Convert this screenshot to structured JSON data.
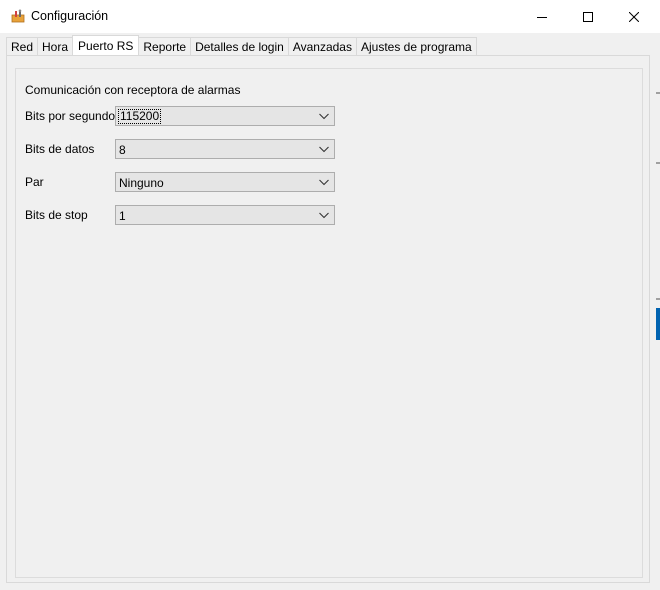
{
  "window": {
    "title": "Configuración",
    "icon": "settings-tools-icon",
    "controls": {
      "minimize_icon": "minimize-icon",
      "maximize_icon": "maximize-icon",
      "close_icon": "close-icon"
    }
  },
  "tabs": [
    {
      "label": "Red",
      "active": false
    },
    {
      "label": "Hora",
      "active": false
    },
    {
      "label": "Puerto RS",
      "active": true
    },
    {
      "label": "Reporte",
      "active": false
    },
    {
      "label": "Detalles de login",
      "active": false
    },
    {
      "label": "Avanzadas",
      "active": false
    },
    {
      "label": "Ajustes de programa",
      "active": false
    }
  ],
  "panel": {
    "section_title": "Comunicación con receptora de alarmas",
    "fields": [
      {
        "label": "Bits por segundos",
        "value": "115200"
      },
      {
        "label": "Bits de datos",
        "value": "8"
      },
      {
        "label": "Par",
        "value": "Ninguno"
      },
      {
        "label": "Bits de stop",
        "value": "1"
      }
    ]
  },
  "colors": {
    "window_bg": "#f0f0f0",
    "titlebar_bg": "#ffffff",
    "combo_bg": "#e5e5e5",
    "accent": "#0063b1"
  }
}
